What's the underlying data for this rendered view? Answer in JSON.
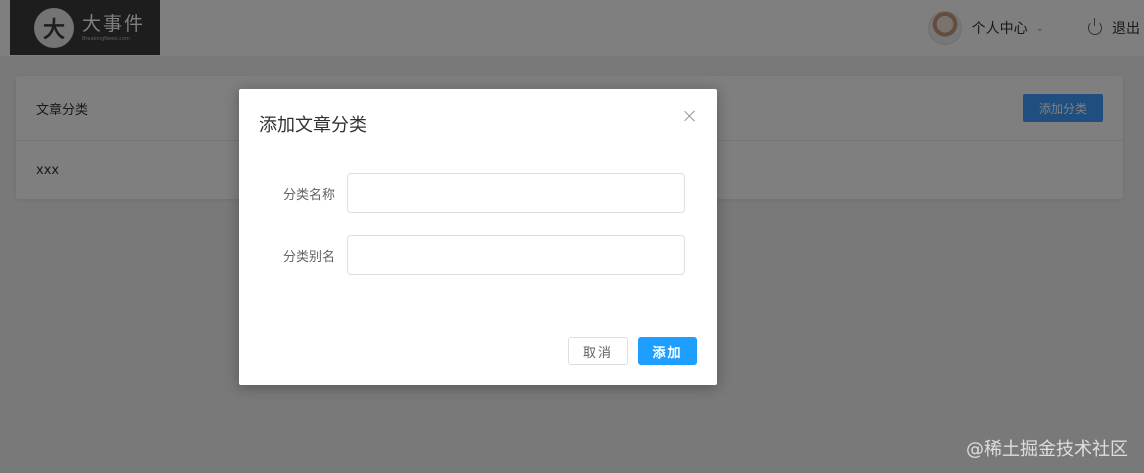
{
  "header": {
    "logo_mark": "大",
    "logo_title": "大事件",
    "logo_sub": "BreakingNews.com",
    "user_center_label": "个人中心",
    "logout_label": "退出"
  },
  "card": {
    "title": "文章分类",
    "add_button_label": "添加分类",
    "body_text": "xxx"
  },
  "dialog": {
    "title": "添加文章分类",
    "fields": [
      {
        "label": "分类名称",
        "value": "",
        "placeholder": ""
      },
      {
        "label": "分类别名",
        "value": "",
        "placeholder": ""
      }
    ],
    "cancel_label": "取消",
    "add_label": "添加"
  },
  "watermark": "@稀土掘金技术社区",
  "colors": {
    "primary": "#1e9fff",
    "accent_blue": "#409eff",
    "logo_bg": "#3a3a3a"
  },
  "icons": {
    "user_dropdown": "chevron-down-icon",
    "logout": "power-icon",
    "dialog_close": "close-icon"
  }
}
